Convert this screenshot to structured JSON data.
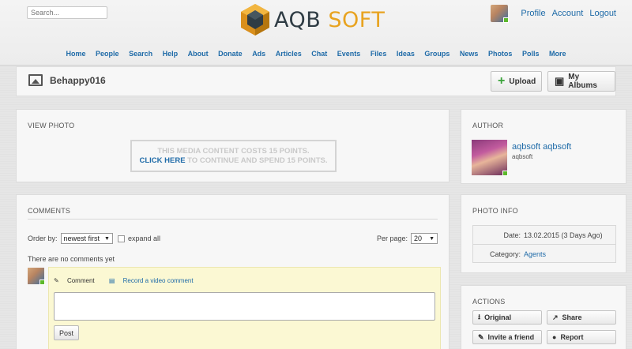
{
  "header": {
    "search_placeholder": "Search...",
    "logo": {
      "part1": "AQB",
      "part2": "SOFT"
    },
    "user_links": [
      "Profile",
      "Account",
      "Logout"
    ]
  },
  "nav": [
    "Home",
    "People",
    "Search",
    "Help",
    "About",
    "Donate",
    "Ads",
    "Articles",
    "Chat",
    "Events",
    "Files",
    "Ideas",
    "Groups",
    "News",
    "Photos",
    "Polls",
    "More"
  ],
  "titlebar": {
    "title": "Behappy016",
    "upload_label": "Upload",
    "albums_label": "My Albums"
  },
  "view_photo": {
    "title": "VIEW PHOTO",
    "cost_line": "THIS MEDIA CONTENT COSTS 15 POINTS.",
    "click_here": "CLICK HERE",
    "continue_text": " TO CONTINUE AND SPEND 15 POINTS."
  },
  "comments": {
    "title": "COMMENTS",
    "order_label": "Order by:",
    "order_value": "newest first",
    "expand_label": "expand all",
    "per_page_label": "Per page:",
    "per_page_value": "20",
    "empty_text": "There are no comments yet",
    "tab_comment": "Comment",
    "tab_video": "Record a video comment",
    "post_label": "Post"
  },
  "author": {
    "title": "AUTHOR",
    "name": "aqbsoft aqbsoft",
    "username": "aqbsoft"
  },
  "photo_info": {
    "title": "PHOTO INFO",
    "date_label": "Date:",
    "date_value": "13.02.2015 (3 Days Ago)",
    "category_label": "Category:",
    "category_value": "Agents"
  },
  "actions": {
    "title": "ACTIONS",
    "original": "Original",
    "share": "Share",
    "invite": "Invite a friend",
    "report": "Report"
  },
  "colors": {
    "accent": "#1f6ba8",
    "logo_orange": "#e8a320",
    "online": "#5cb82c",
    "comment_bg": "#fbf8d3"
  }
}
